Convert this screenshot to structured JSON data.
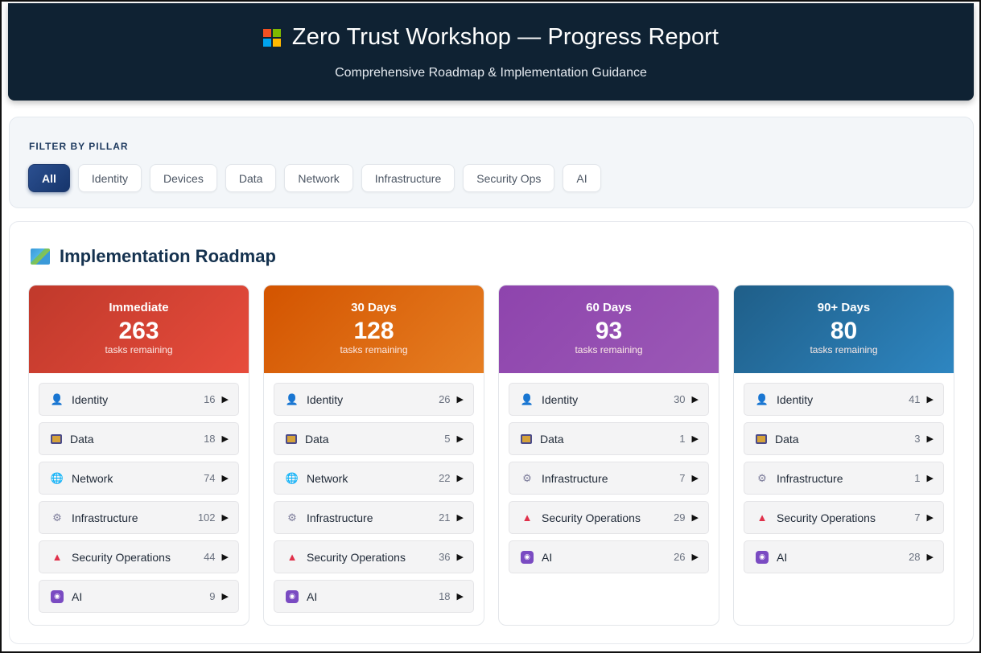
{
  "header": {
    "title": "Zero Trust Workshop — Progress Report",
    "subtitle": "Comprehensive Roadmap & Implementation Guidance",
    "logo_colors": [
      "#f25022",
      "#7fba00",
      "#00a4ef",
      "#ffb900"
    ]
  },
  "filter": {
    "label": "FILTER BY PILLAR",
    "chips": [
      {
        "label": "All",
        "active": true
      },
      {
        "label": "Identity"
      },
      {
        "label": "Devices"
      },
      {
        "label": "Data"
      },
      {
        "label": "Network"
      },
      {
        "label": "Infrastructure"
      },
      {
        "label": "Security Ops"
      },
      {
        "label": "AI"
      }
    ]
  },
  "roadmap": {
    "title": "Implementation Roadmap",
    "columns": [
      {
        "period": "Immediate",
        "count": "263",
        "sub": "tasks remaining",
        "color": "#e74c3c",
        "items": [
          {
            "icon": "person-icon",
            "name": "Identity",
            "count": "16"
          },
          {
            "icon": "data-icon",
            "name": "Data",
            "count": "18"
          },
          {
            "icon": "globe-icon",
            "name": "Network",
            "count": "74"
          },
          {
            "icon": "gear-icon",
            "name": "Infrastructure",
            "count": "102"
          },
          {
            "icon": "siren-icon",
            "name": "Security Operations",
            "count": "44"
          },
          {
            "icon": "robot-icon",
            "name": "AI",
            "count": "9"
          }
        ]
      },
      {
        "period": "30 Days",
        "count": "128",
        "sub": "tasks remaining",
        "color": "#e67e22",
        "items": [
          {
            "icon": "person-icon",
            "name": "Identity",
            "count": "26"
          },
          {
            "icon": "data-icon",
            "name": "Data",
            "count": "5"
          },
          {
            "icon": "globe-icon",
            "name": "Network",
            "count": "22"
          },
          {
            "icon": "gear-icon",
            "name": "Infrastructure",
            "count": "21"
          },
          {
            "icon": "siren-icon",
            "name": "Security Operations",
            "count": "36"
          },
          {
            "icon": "robot-icon",
            "name": "AI",
            "count": "18"
          }
        ]
      },
      {
        "period": "60 Days",
        "count": "93",
        "sub": "tasks remaining",
        "color": "#9b59b6",
        "items": [
          {
            "icon": "person-icon",
            "name": "Identity",
            "count": "30"
          },
          {
            "icon": "data-icon",
            "name": "Data",
            "count": "1"
          },
          {
            "icon": "gear-icon",
            "name": "Infrastructure",
            "count": "7"
          },
          {
            "icon": "siren-icon",
            "name": "Security Operations",
            "count": "29"
          },
          {
            "icon": "robot-icon",
            "name": "AI",
            "count": "26"
          }
        ]
      },
      {
        "period": "90+ Days",
        "count": "80",
        "sub": "tasks remaining",
        "color": "#2e86c1",
        "items": [
          {
            "icon": "person-icon",
            "name": "Identity",
            "count": "41"
          },
          {
            "icon": "data-icon",
            "name": "Data",
            "count": "3"
          },
          {
            "icon": "gear-icon",
            "name": "Infrastructure",
            "count": "1"
          },
          {
            "icon": "siren-icon",
            "name": "Security Operations",
            "count": "7"
          },
          {
            "icon": "robot-icon",
            "name": "AI",
            "count": "28"
          }
        ]
      }
    ]
  }
}
